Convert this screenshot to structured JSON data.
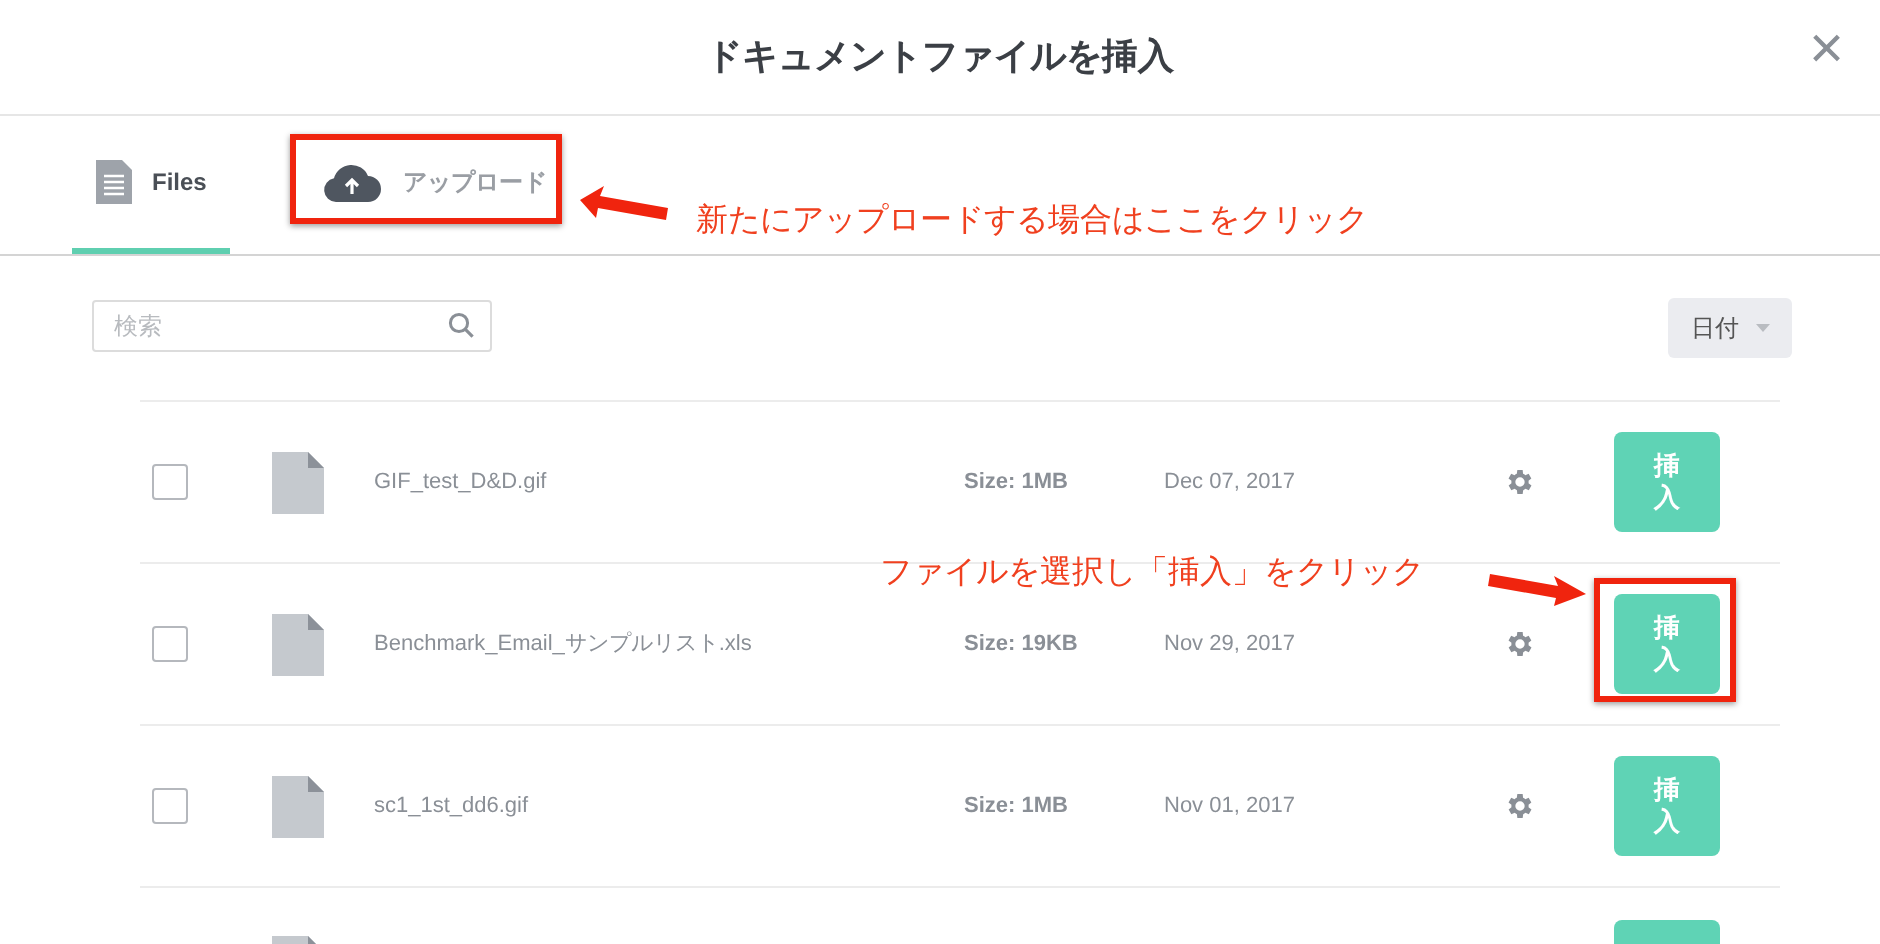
{
  "dialog": {
    "title": "ドキュメントファイルを挿入",
    "close": "×"
  },
  "tabs": [
    {
      "label": "Files",
      "kind": "files",
      "selected": true
    },
    {
      "label": "アップロード",
      "kind": "upload",
      "selected": false
    }
  ],
  "search": {
    "placeholder": "検索"
  },
  "sort": {
    "label": "日付"
  },
  "files": [
    {
      "kind": "file",
      "checked": false,
      "name": "GIF_test_D&D.gif",
      "size": "Size: 1MB",
      "date": "Dec 07, 2017",
      "button": "挿入"
    },
    {
      "kind": "file",
      "checked": false,
      "name": "Benchmark_Email_サンプルリスト.xls",
      "size": "Size: 19KB",
      "date": "Nov 29, 2017",
      "button": "挿入"
    },
    {
      "kind": "file",
      "checked": false,
      "name": "sc1_1st_dd6.gif",
      "size": "Size: 1MB",
      "date": "Nov 01, 2017",
      "button": "挿入"
    },
    {
      "kind": "partial"
    }
  ],
  "annotations": [
    {
      "text": "新たにアップロードする場合はここをクリック"
    },
    {
      "text": "ファイルを選択し「挿入」をクリック"
    }
  ]
}
